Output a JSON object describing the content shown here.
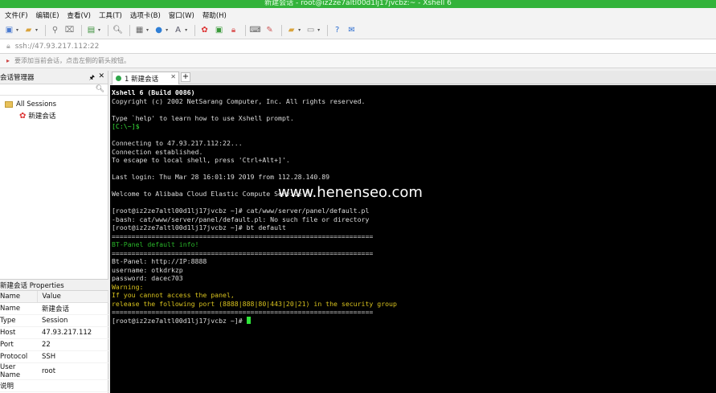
{
  "title": "新建会话 - root@iz2ze7altl00d1lj17jvcbz:~ - Xshell 6",
  "menu": [
    "文件(F)",
    "编辑(E)",
    "查看(V)",
    "工具(T)",
    "选项卡(B)",
    "窗口(W)",
    "帮助(H)"
  ],
  "address": "ssh://47.93.217.112:22",
  "hint": "要添加当前会话，点击左侧的箭头按钮。",
  "session_manager": {
    "title": "会话管理器",
    "root": "All Sessions",
    "session": "新建会话"
  },
  "properties": {
    "title": "新建会话 Properties",
    "headers": [
      "Name",
      "Value"
    ],
    "rows": [
      [
        "Name",
        "新建会话"
      ],
      [
        "Type",
        "Session"
      ],
      [
        "Host",
        "47.93.217.112"
      ],
      [
        "Port",
        "22"
      ],
      [
        "Protocol",
        "SSH"
      ],
      [
        "User Name",
        "root"
      ],
      [
        "说明",
        ""
      ]
    ]
  },
  "tab": {
    "label": "1 新建会话"
  },
  "terminal": {
    "lines": [
      {
        "t": "Xshell 6 (Build 0086)",
        "s": "bold"
      },
      {
        "t": "Copyright (c) 2002 NetSarang Computer, Inc. All rights reserved.",
        "s": ""
      },
      {
        "t": "",
        "s": ""
      },
      {
        "t": "Type `help' to learn how to use Xshell prompt.",
        "s": ""
      },
      {
        "t": "[C:\\~]$",
        "s": "gbright"
      },
      {
        "t": "",
        "s": ""
      },
      {
        "t": "Connecting to 47.93.217.112:22...",
        "s": ""
      },
      {
        "t": "Connection established.",
        "s": ""
      },
      {
        "t": "To escape to local shell, press 'Ctrl+Alt+]'.",
        "s": ""
      },
      {
        "t": "",
        "s": ""
      },
      {
        "t": "Last login: Thu Mar 28 16:01:19 2019 from 112.28.140.89",
        "s": ""
      },
      {
        "t": "",
        "s": ""
      },
      {
        "t": "Welcome to Alibaba Cloud Elastic Compute Service !",
        "s": ""
      },
      {
        "t": "",
        "s": ""
      },
      {
        "t": "[root@iz2ze7altl00d1lj17jvcbz ~]# cat/www/server/panel/default.pl",
        "s": ""
      },
      {
        "t": "-bash: cat/www/server/panel/default.pl: No such file or directory",
        "s": ""
      },
      {
        "t": "[root@iz2ze7altl00d1lj17jvcbz ~]# bt default",
        "s": ""
      },
      {
        "t": "==================================================================",
        "s": ""
      },
      {
        "t": "BT-Panel default info!",
        "s": "green"
      },
      {
        "t": "==================================================================",
        "s": ""
      },
      {
        "t": "Bt-Panel: http://IP:8888",
        "s": ""
      },
      {
        "t": "username: otkdrkzp",
        "s": ""
      },
      {
        "t": "password: dacec703",
        "s": ""
      },
      {
        "t": "Warning:",
        "s": "yellow"
      },
      {
        "t": "If you cannot access the panel,",
        "s": "yellow"
      },
      {
        "t": "release the following port (8888|888|80|443|20|21) in the security group",
        "s": "yellow"
      },
      {
        "t": "==================================================================",
        "s": ""
      },
      {
        "t": "[root@iz2ze7altl00d1lj17jvcbz ~]# ",
        "s": "",
        "cursor": true
      }
    ]
  },
  "watermark": "www.henenseo.com",
  "colors": {
    "titlebar": "#33b33b",
    "prompt_green": "#39e03a",
    "warning_yellow": "#d8c21e",
    "cursor": "#2fe53a"
  }
}
